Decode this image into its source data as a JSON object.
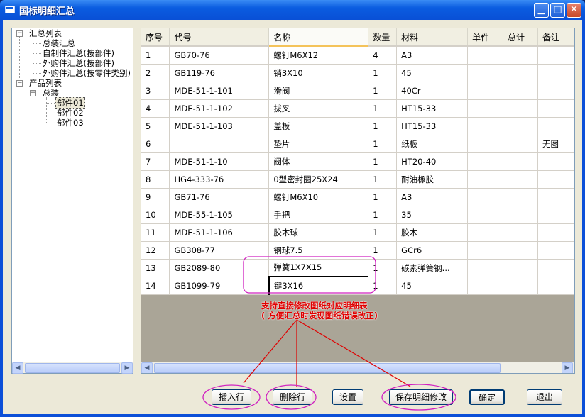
{
  "window": {
    "title": "国标明细汇总"
  },
  "tree": {
    "groups": [
      {
        "label": "汇总列表",
        "expander": "−",
        "children": [
          "总装汇总",
          "自制件汇总(按部件)",
          "外购件汇总(按部件)",
          "外购件汇总(按零件类别)"
        ]
      },
      {
        "label": "产品列表",
        "expander": "−",
        "child": {
          "label": "总装",
          "expander": "−",
          "children": [
            "部件01",
            "部件02",
            "部件03"
          ]
        }
      }
    ]
  },
  "grid": {
    "columns": [
      "序号",
      "代号",
      "名称",
      "数量",
      "材料",
      "单件",
      "总计",
      "备注"
    ],
    "rows": [
      [
        "1",
        "GB70-76",
        "螺钉M6X12",
        "4",
        "A3",
        "",
        "",
        ""
      ],
      [
        "2",
        "GB119-76",
        "销3X10",
        "1",
        "45",
        "",
        "",
        ""
      ],
      [
        "3",
        "MDE-51-1-101",
        "滑阀",
        "1",
        "40Cr",
        "",
        "",
        ""
      ],
      [
        "4",
        "MDE-51-1-102",
        "拔叉",
        "1",
        "HT15-33",
        "",
        "",
        ""
      ],
      [
        "5",
        "MDE-51-1-103",
        "盖板",
        "1",
        "HT15-33",
        "",
        "",
        ""
      ],
      [
        "6",
        "",
        "垫片",
        "1",
        "纸板",
        "",
        "",
        "无图"
      ],
      [
        "7",
        "MDE-51-1-10",
        "阀体",
        "1",
        "HT20-40",
        "",
        "",
        ""
      ],
      [
        "8",
        "HG4-333-76",
        "0型密封圈25X24",
        "1",
        "耐油橡胶",
        "",
        "",
        ""
      ],
      [
        "9",
        "GB71-76",
        "螺钉M6X10",
        "1",
        "A3",
        "",
        "",
        ""
      ],
      [
        "10",
        "MDE-55-1-105",
        "手把",
        "1",
        "35",
        "",
        "",
        ""
      ],
      [
        "11",
        "MDE-51-1-106",
        "胶木球",
        "1",
        "胶木",
        "",
        "",
        ""
      ],
      [
        "12",
        "GB308-77",
        "钢球7.5",
        "1",
        "GCr6",
        "",
        "",
        ""
      ],
      [
        "13",
        "GB2089-80",
        "弹簧1X7X15",
        "1",
        "碳素弹簧钢...",
        "",
        "",
        ""
      ],
      [
        "14",
        "GB1099-79",
        "键3X16",
        "1",
        "45",
        "",
        "",
        ""
      ]
    ]
  },
  "annotation": {
    "line1": "支持直接修改图纸对应明细表",
    "line2": "( 方便汇总时发现图纸错误改正)"
  },
  "buttons": {
    "insert_row": "插入行",
    "delete_row": "删除行",
    "settings": "设置",
    "save_changes": "保存明细修改",
    "ok": "确定",
    "exit": "退出"
  },
  "colors": {
    "annotation_red": "#e00000",
    "ellipse": "#d020c0",
    "title_blue": "#0a5ce0"
  }
}
